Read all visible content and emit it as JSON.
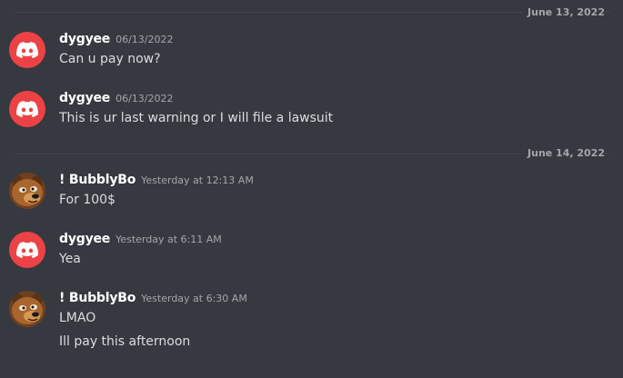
{
  "conversation": {
    "dividers": [
      {
        "date": "June 13, 2022"
      },
      {
        "date": "June 14, 2022"
      }
    ],
    "messages": [
      {
        "author": "dygyee",
        "timestamp": "06/13/2022",
        "avatar_icon": "discord-logo-icon",
        "avatar_color": "#ed4245",
        "lines": [
          "Can u pay now?"
        ]
      },
      {
        "author": "dygyee",
        "timestamp": "06/13/2022",
        "avatar_icon": "discord-logo-icon",
        "avatar_color": "#ed4245",
        "lines": [
          "This is ur last warning or I will file a lawsuit"
        ]
      },
      {
        "author": "!  BubblyBo",
        "timestamp": "Yesterday at 12:13 AM",
        "avatar_icon": "bear-avatar-icon",
        "lines": [
          "For 100$"
        ]
      },
      {
        "author": "dygyee",
        "timestamp": "Yesterday at 6:11 AM",
        "avatar_icon": "discord-logo-icon",
        "avatar_color": "#ed4245",
        "lines": [
          "Yea"
        ]
      },
      {
        "author": "!  BubblyBo",
        "timestamp": "Yesterday at 6:30 AM",
        "avatar_icon": "bear-avatar-icon",
        "lines": [
          "LMAO",
          "Ill pay this afternoon"
        ]
      }
    ]
  },
  "colors": {
    "background": "#36393f",
    "username": "#ffffff",
    "message_text": "#dcddde",
    "muted_text": "#a3a6aa",
    "discord_red": "#ed4245"
  }
}
